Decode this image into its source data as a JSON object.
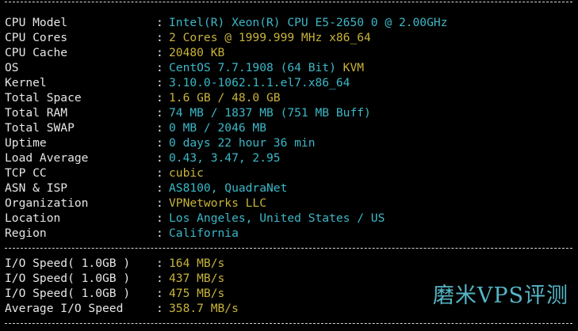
{
  "system": [
    {
      "label": "CPU Model",
      "value": "Intel(R) Xeon(R) CPU E5-2650 0 @ 2.00GHz",
      "value_color": "cyan"
    },
    {
      "label": "CPU Cores",
      "value": "2 Cores @ 1999.999 MHz x86_64",
      "value_color": "yellow"
    },
    {
      "label": "CPU Cache",
      "value": "20480 KB",
      "value_color": "yellow"
    },
    {
      "label": "OS",
      "value": "CentOS 7.7.1908 (64 Bit)",
      "value_extra": "KVM",
      "value_color": "cyan",
      "value_extra_color": "yellow"
    },
    {
      "label": "Kernel",
      "value": "3.10.0-1062.1.1.el7.x86_64",
      "value_color": "cyan"
    },
    {
      "label": "Total Space",
      "value": "1.6 GB / 48.0 GB",
      "value_color": "yellow"
    },
    {
      "label": "Total RAM",
      "value": "74 MB / 1837 MB (751 MB Buff)",
      "value_color": "cyan"
    },
    {
      "label": "Total SWAP",
      "value": "0 MB / 2046 MB",
      "value_color": "cyan"
    },
    {
      "label": "Uptime",
      "value": "0 days 22 hour 36 min",
      "value_color": "cyan"
    },
    {
      "label": "Load Average",
      "value": "0.43, 3.47, 2.95",
      "value_color": "cyan"
    },
    {
      "label": "TCP CC",
      "value": "cubic",
      "value_color": "yellow"
    },
    {
      "label": "ASN & ISP",
      "value": "AS8100, QuadraNet",
      "value_color": "cyan"
    },
    {
      "label": "Organization",
      "value": "VPNetworks LLC",
      "value_color": "yellow"
    },
    {
      "label": "Location",
      "value": "Los Angeles, United States / US",
      "value_color": "cyan"
    },
    {
      "label": "Region",
      "value": "California",
      "value_color": "cyan"
    }
  ],
  "io": [
    {
      "label": "I/O Speed( 1.0GB )",
      "value": "164 MB/s",
      "value_color": "yellow"
    },
    {
      "label": "I/O Speed( 1.0GB )",
      "value": "437 MB/s",
      "value_color": "yellow"
    },
    {
      "label": "I/O Speed( 1.0GB )",
      "value": "475 MB/s",
      "value_color": "yellow"
    },
    {
      "label": "Average I/O Speed",
      "value": "358.7 MB/s",
      "value_color": "yellow"
    }
  ],
  "colon": ":",
  "watermark": "磨米VPS评测",
  "colors": {
    "background": "#000000",
    "text": "#e6e6e6",
    "cyan": "#3bb8c8",
    "yellow": "#c8b43a",
    "watermark": "#56b5c6"
  }
}
